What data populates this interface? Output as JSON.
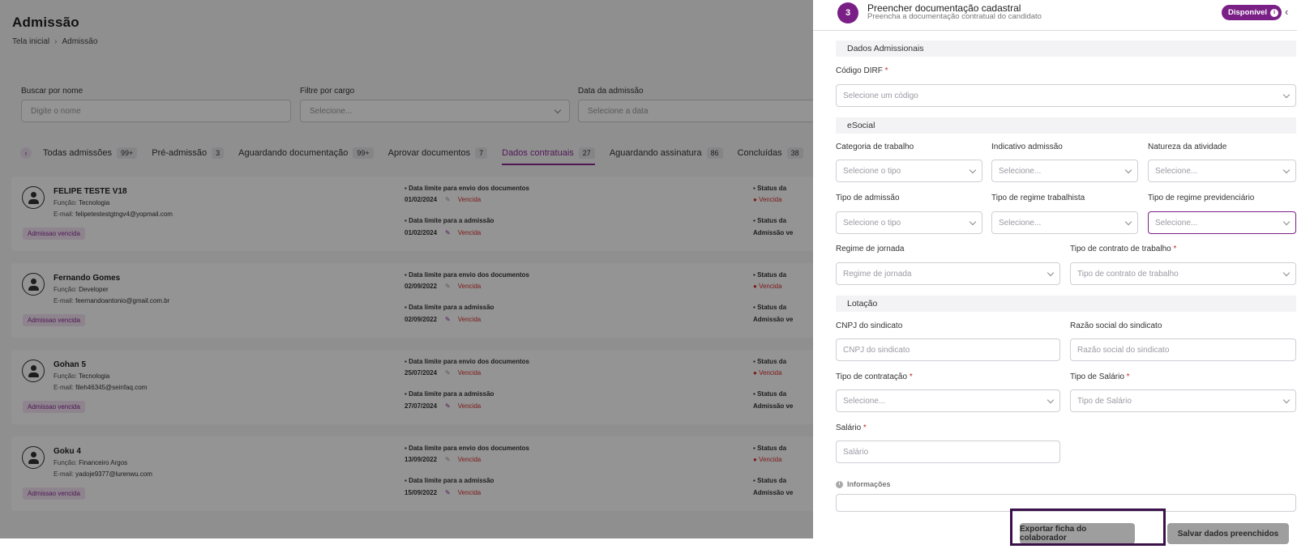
{
  "page": {
    "title": "Admissão",
    "breadcrumb": {
      "home": "Tela inicial",
      "sep": "›",
      "current": "Admissão"
    }
  },
  "filters": {
    "name": {
      "label": "Buscar por nome",
      "placeholder": "Digite o nome"
    },
    "cargo": {
      "label": "Filtre por cargo",
      "placeholder": "Selecione..."
    },
    "date": {
      "label": "Data da admissão",
      "placeholder": "Selecione a data"
    }
  },
  "tabs": [
    {
      "label": "Todas admissões",
      "count": "99+"
    },
    {
      "label": "Pré-admissão",
      "count": "3"
    },
    {
      "label": "Aguardando documentação",
      "count": "99+"
    },
    {
      "label": "Aprovar documentos",
      "count": "7"
    },
    {
      "label": "Dados contratuais",
      "count": "27",
      "active": true
    },
    {
      "label": "Aguardando assinatura",
      "count": "86"
    },
    {
      "label": "Concluídas",
      "count": "38"
    }
  ],
  "labels": {
    "funcao": "Função:",
    "email": "E-mail:",
    "deadline_docs": "Data limite para envio dos documentos",
    "deadline_adm": "Data limite para a admissão",
    "vencida": "Vencida",
    "status_a": "Status da",
    "status_b": "Status da",
    "status_adm": "Admissão ve"
  },
  "cards": [
    {
      "name": "FELIPE TESTE V18",
      "funcao": "Tecnologia",
      "email": "felipetestestgtngv4@yopmail.com",
      "badge": "Admissao vencida",
      "date_docs": "01/02/2024",
      "date_adm": "01/02/2024"
    },
    {
      "name": "Fernando Gomes",
      "funcao": "Developer",
      "email": "feernandoantonio@gmail.com.br",
      "badge": "Admissao vencida",
      "date_docs": "02/09/2022",
      "date_adm": "02/09/2022"
    },
    {
      "name": "Gohan 5",
      "funcao": "Tecnologia",
      "email": "fileh46345@seinfaq.com",
      "badge": "Admissao vencida",
      "date_docs": "25/07/2024",
      "date_adm": "27/07/2024"
    },
    {
      "name": "Goku 4",
      "funcao": "Financeiro Argos",
      "email": "yadoje9377@lurenwu.com",
      "badge": "Admissao vencida",
      "date_docs": "13/09/2022",
      "date_adm": "15/09/2022"
    }
  ],
  "drawer": {
    "step": "3",
    "title": "Preencher documentação cadastral",
    "subtitle": "Preencha a documentação contratual do candidato",
    "badge": "Disponível",
    "badge_icon": "i",
    "close": "‹",
    "sections": {
      "admissionais": "Dados Admissionais",
      "esocial": "eSocial",
      "lotacao": "Lotação"
    },
    "fields": {
      "dirf": {
        "label": "Código DIRF",
        "placeholder": "Selecione um código"
      },
      "categoria": {
        "label": "Categoria de trabalho",
        "placeholder": "Selecione o tipo"
      },
      "indicativo": {
        "label": "Indicativo admissão",
        "placeholder": "Selecione..."
      },
      "natureza": {
        "label": "Natureza da atividade",
        "placeholder": "Selecione..."
      },
      "tipo_admissao": {
        "label": "Tipo de admissão",
        "placeholder": "Selecione o tipo"
      },
      "regime_trab": {
        "label": "Tipo de regime trabalhista",
        "placeholder": "Selecione..."
      },
      "regime_prev": {
        "label": "Tipo de regime previdenciário",
        "placeholder": "Selecione..."
      },
      "jornada": {
        "label": "Regime de jornada",
        "placeholder": "Regime de jornada"
      },
      "contrato": {
        "label": "Tipo de contrato de trabalho",
        "placeholder": "Tipo de contrato de trabalho"
      },
      "cnpj": {
        "label": "CNPJ do sindicato",
        "placeholder": "CNPJ do sindicato"
      },
      "razao": {
        "label": "Razão social do sindicato",
        "placeholder": "Razão social do sindicato"
      },
      "contratacao": {
        "label": "Tipo de contratação",
        "placeholder": "Selecione..."
      },
      "tipo_salario": {
        "label": "Tipo de Salário",
        "placeholder": "Tipo de Salário"
      },
      "salario": {
        "label": "Salário",
        "placeholder": "Salário"
      }
    },
    "required_mark": "*",
    "info_label": "Informações",
    "buttons": {
      "export": "Exportar ficha do colaborador",
      "save": "Salvar dados preenchidos"
    }
  },
  "colors": {
    "brand": "#7a1f86",
    "danger": "#d93030",
    "highlight": "#3a1048"
  }
}
